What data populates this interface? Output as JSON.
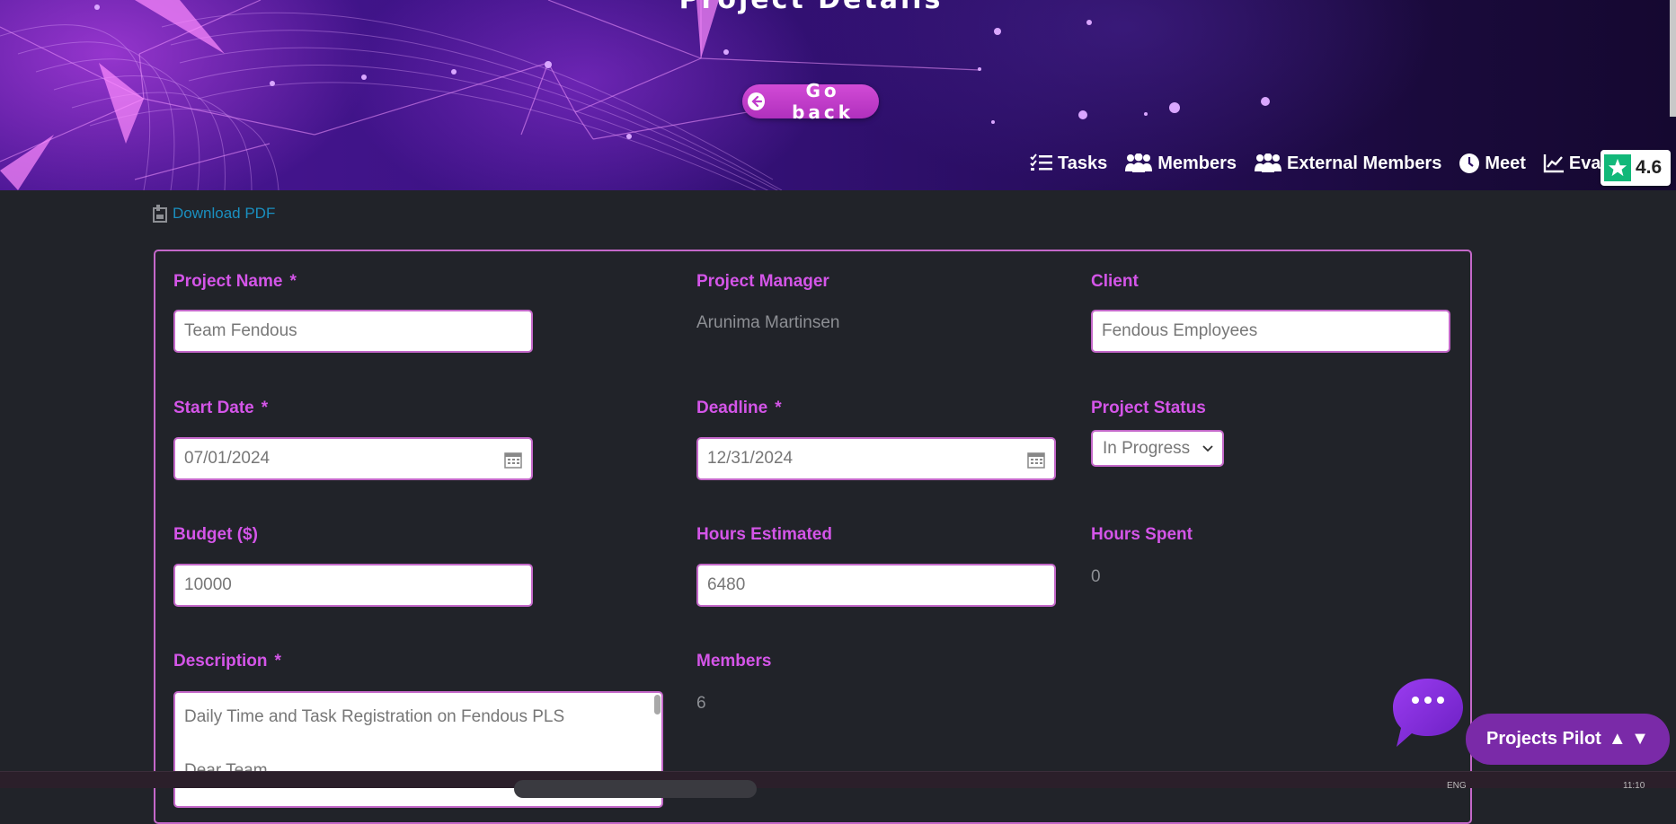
{
  "banner": {
    "title": "Project Details",
    "go_back_label": "Go back",
    "nav": [
      {
        "label": "Tasks",
        "icon": "tasks-icon"
      },
      {
        "label": "Members",
        "icon": "users-icon"
      },
      {
        "label": "External Members",
        "icon": "users-icon"
      },
      {
        "label": "Meet",
        "icon": "clock-icon"
      },
      {
        "label": "Eva",
        "icon": "chart-line-icon"
      }
    ],
    "rating": {
      "score": "4.6",
      "icon": "star-icon",
      "color": "#12b879"
    }
  },
  "download_label": "Download PDF",
  "form": {
    "project_name": {
      "label": "Project Name",
      "required": "*",
      "value": "Team Fendous"
    },
    "project_manager": {
      "label": "Project Manager",
      "value": "Arunima Martinsen"
    },
    "client": {
      "label": "Client",
      "value": "Fendous Employees"
    },
    "start_date": {
      "label": "Start Date",
      "required": "*",
      "value": "07/01/2024"
    },
    "deadline": {
      "label": "Deadline",
      "required": "*",
      "value": "12/31/2024"
    },
    "project_status": {
      "label": "Project Status",
      "value": "In Progress"
    },
    "budget": {
      "label": "Budget ($)",
      "value": "10000"
    },
    "hours_estimated": {
      "label": "Hours Estimated",
      "value": "6480"
    },
    "hours_spent": {
      "label": "Hours Spent",
      "value": "0"
    },
    "description": {
      "label": "Description",
      "required": "*",
      "line1": "Daily Time and Task Registration on Fendous PLS",
      "line2": "Dear Team,"
    },
    "members": {
      "label": "Members",
      "value": "6"
    }
  },
  "chat": {
    "pilot_label": "Projects Pilot",
    "pilot_arrows": "▲ ▼"
  },
  "colors": {
    "accent": "#d455e8",
    "border": "#c468c9",
    "background": "#212329",
    "link": "#1a8fbf"
  },
  "taskbar": {
    "lang": "ENG",
    "time": "11:10"
  }
}
